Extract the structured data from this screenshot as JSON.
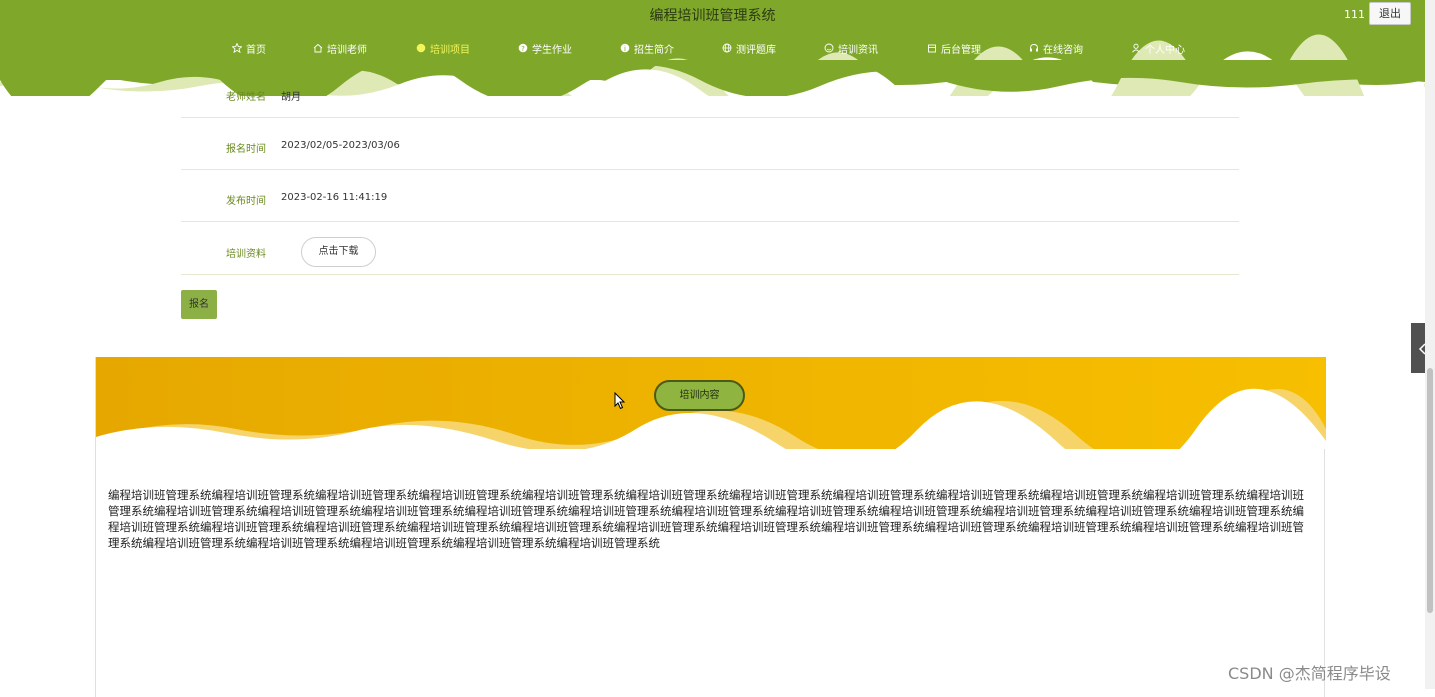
{
  "header": {
    "title": "编程培训班管理系统",
    "user": "111",
    "logout_label": "退出",
    "bg_color": "#7fa82a"
  },
  "nav": {
    "items": [
      {
        "label": "首页",
        "icon": "star-icon"
      },
      {
        "label": "培训老师",
        "icon": "home-icon"
      },
      {
        "label": "培训项目",
        "icon": "circle-icon",
        "active": true
      },
      {
        "label": "学生作业",
        "icon": "question-icon"
      },
      {
        "label": "招生简介",
        "icon": "info-icon"
      },
      {
        "label": "测评题库",
        "icon": "globe-icon"
      },
      {
        "label": "培训资讯",
        "icon": "smile-icon"
      },
      {
        "label": "后台管理",
        "icon": "box-icon"
      },
      {
        "label": "在线咨询",
        "icon": "headset-icon"
      },
      {
        "label": "个人中心",
        "icon": "user-icon"
      }
    ]
  },
  "detail": {
    "rows": [
      {
        "label": "老师姓名",
        "value": "胡月"
      },
      {
        "label": "报名时间",
        "value": "2023/02/05-2023/03/06"
      },
      {
        "label": "发布时间",
        "value": "2023-02-16 11:41:19"
      },
      {
        "label": "培训资料",
        "button": "点击下载"
      }
    ],
    "signup_label": "报名"
  },
  "panel": {
    "tab_label": "培训内容",
    "banner_color": "#f2b400",
    "content": "编程培训班管理系统编程培训班管理系统编程培训班管理系统编程培训班管理系统编程培训班管理系统编程培训班管理系统编程培训班管理系统编程培训班管理系统编程培训班管理系统编程培训班管理系统编程培训班管理系统编程培训班管理系统编程培训班管理系统编程培训班管理系统编程培训班管理系统编程培训班管理系统编程培训班管理系统编程培训班管理系统编程培训班管理系统编程培训班管理系统编程培训班管理系统编程培训班管理系统编程培训班管理系统编程培训班管理系统编程培训班管理系统编程培训班管理系统编程培训班管理系统编程培训班管理系统编程培训班管理系统编程培训班管理系统编程培训班管理系统编程培训班管理系统编程培训班管理系统编程培训班管理系统编程培训班管理系统编程培训班管理系统编程培训班管理系统编程培训班管理系统编程培训班管理系统编程培训班管理系统"
  },
  "side_toggle_icon": "chevron-left-icon",
  "watermark": "CSDN @杰简程序毕设"
}
